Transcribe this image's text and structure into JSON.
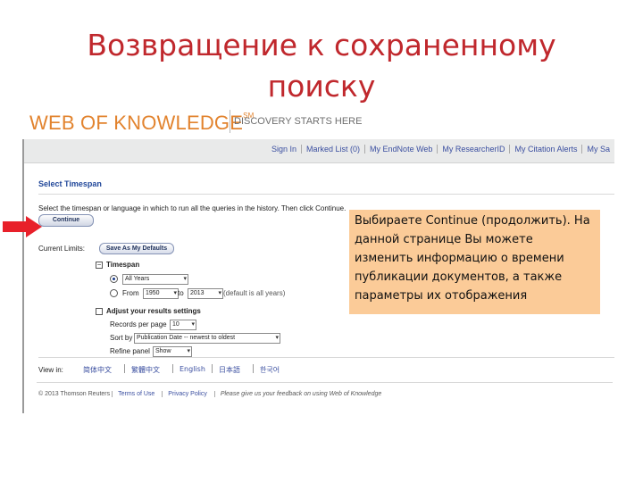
{
  "slide": {
    "title_line1": "Возвращение к сохраненному",
    "title_line2": "поиску",
    "callout_text": "Выбираете Continue (продолжить). На данной странице Вы можете изменить информацию о времени публикации документов, а также параметры их отображения"
  },
  "header": {
    "logo": "WEB OF KNOWLEDGE",
    "logo_mark": "SM",
    "tagline": "DISCOVERY STARTS HERE"
  },
  "nav": [
    "Sign In",
    "Marked List (0)",
    "My EndNote Web",
    "My ResearcherID",
    "My Citation Alerts",
    "My Sa"
  ],
  "panel": {
    "title": "Select Timespan",
    "instruction": "Select the timespan or language in which to run all the queries in the history. Then click Continue.",
    "continue_label": "Continue",
    "current_limits_label": "Current Limits:",
    "save_defaults_label": "Save As My Defaults",
    "timespan_label": "Timespan",
    "all_years_value": "All Years",
    "from_label": "From",
    "from_value": "1950",
    "to_label": "to",
    "to_value": "2013",
    "to_hint": "(default is all years)",
    "adjust_label": "Adjust your results settings",
    "records_label": "Records per page",
    "records_value": "10",
    "sort_label": "Sort by",
    "sort_value": "Publication Date -- newest to oldest",
    "refine_label": "Refine panel",
    "refine_value": "Show"
  },
  "view_in": {
    "label": "View in:",
    "languages": [
      "简体中文",
      "繁體中文",
      "English",
      "日本語",
      "한국어"
    ]
  },
  "footer": {
    "copyright": "© 2013 Thomson Reuters",
    "terms": "Terms of Use",
    "privacy": "Privacy Policy",
    "feedback": "Please give us your feedback on using Web of Knowledge"
  },
  "colors": {
    "title_red": "#c0282d",
    "logo_orange": "#e2832e",
    "callout_bg": "#fbcb98",
    "arrow_red": "#e8202a",
    "link_blue": "#3b4fa0"
  }
}
